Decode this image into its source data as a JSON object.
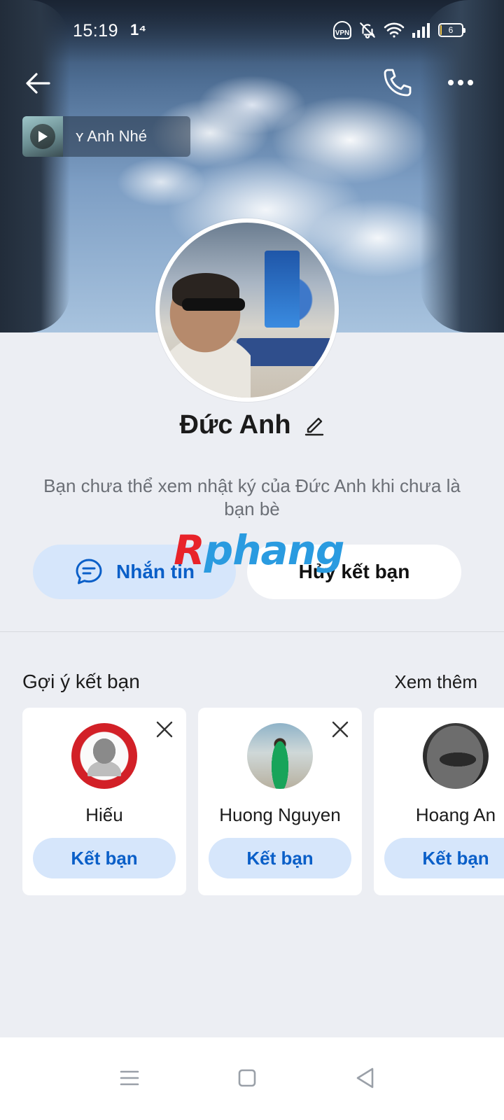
{
  "status_bar": {
    "time": "15:19",
    "data_indicator": "1⁴",
    "vpn_label": "VPN",
    "battery_level_text": "6",
    "battery_fraction": 0.06
  },
  "music": {
    "title": "ʏ Anh Nhé"
  },
  "profile": {
    "name": "Đức Anh",
    "privacy_note": "Bạn chưa thể xem nhật ký của Đức Anh khi chưa là bạn bè"
  },
  "actions": {
    "message_label": "Nhắn tin",
    "unfriend_label": "Hủy kết bạn"
  },
  "watermark": {
    "part_a": "R",
    "part_b": "phang"
  },
  "suggestions": {
    "title": "Gợi ý kết bạn",
    "see_more": "Xem thêm",
    "cards": [
      {
        "name": "Hiếu",
        "button": "Kết bạn"
      },
      {
        "name": "Huong Nguyen",
        "button": "Kết bạn"
      },
      {
        "name": "Hoang An",
        "button": "Kết bạn"
      }
    ]
  },
  "colors": {
    "accent": "#0a5fc8",
    "accent_light": "#d6e6fb",
    "page_bg": "#eceef3"
  },
  "icons": {
    "back": "arrow-left-icon",
    "call": "phone-icon",
    "more": "more-dots-icon",
    "edit": "pencil-icon",
    "message": "chat-bubble-icon",
    "close": "close-icon"
  }
}
